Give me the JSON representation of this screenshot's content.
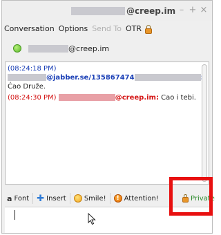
{
  "window": {
    "title_suffix": "@creep.im",
    "controls": {
      "minimize": "–",
      "maximize": "+",
      "close": "×"
    }
  },
  "menu": {
    "items": [
      "Conversation",
      "Options",
      "Send To",
      "OTR"
    ],
    "disabled": [
      "Send To"
    ]
  },
  "contact": {
    "domain": "@creep.im",
    "status": "online",
    "status_color": "#5cb82a"
  },
  "messages": [
    {
      "timestamp": "(08:24:18 PM)",
      "sender_suffix": "@jabber.se/135867474",
      "sender_end": ":",
      "text": "Ćao Druže.",
      "color": "#1a3fb6"
    },
    {
      "timestamp": "(08:24:30 PM)",
      "sender_suffix": "@creep.im:",
      "text": "Cao i tebi.",
      "color": "#d41515"
    }
  ],
  "toolbar": {
    "font": "Font",
    "insert": "Insert",
    "smile": "Smile!",
    "attention": "Attention!",
    "private": "Private"
  },
  "colors": {
    "highlight": "#e81010",
    "private_text": "#2a8a2a"
  }
}
